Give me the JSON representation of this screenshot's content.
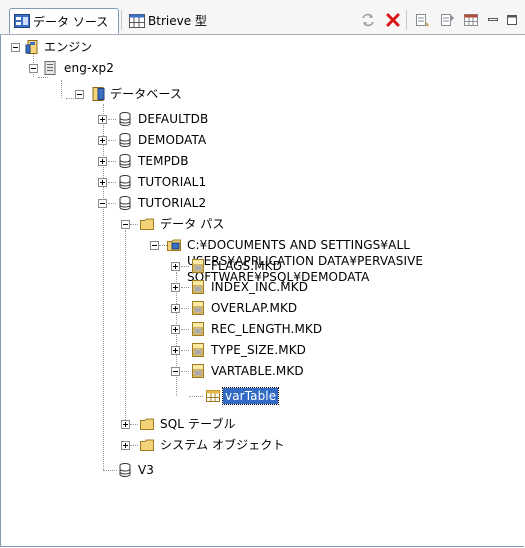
{
  "tabs": [
    {
      "label": "データ ソース",
      "icon": "data-source-icon",
      "active": true
    },
    {
      "label": "Btrieve 型",
      "icon": "btrieve-icon",
      "active": false
    }
  ],
  "toolbar": {
    "buttons": [
      {
        "name": "refresh-icon"
      },
      {
        "name": "delete-icon"
      },
      {
        "name": "table-properties-icon"
      },
      {
        "name": "table-properties-2-icon"
      },
      {
        "name": "table-grid-icon"
      },
      {
        "name": "minimize-icon"
      },
      {
        "name": "maximize-icon"
      }
    ]
  },
  "tree": {
    "engines": "エンジン",
    "server": "eng-xp2",
    "databases": "データベース",
    "db1": "DEFAULTDB",
    "db2": "DEMODATA",
    "db3": "TEMPDB",
    "db4": "TUTORIAL1",
    "db5": "TUTORIAL2",
    "data_path": "データ パス",
    "path": "C:¥DOCUMENTS AND SETTINGS¥ALL USERS¥APPLICATION DATA¥PERVASIVE SOFTWARE¥PSQL¥DEMODATA",
    "f1": "FLAGS.MKD",
    "f2": "INDEX_INC.MKD",
    "f3": "OVERLAP.MKD",
    "f4": "REC_LENGTH.MKD",
    "f5": "TYPE_SIZE.MKD",
    "f6": "VARTABLE.MKD",
    "table": "varTable",
    "sql_tables": "SQL テーブル",
    "system_objects": "システム オブジェクト",
    "v3": "V3"
  }
}
